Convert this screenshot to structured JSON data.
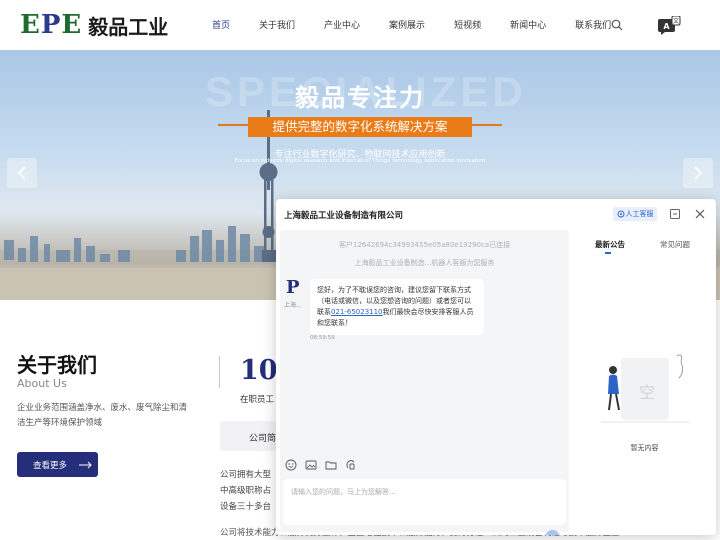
{
  "header": {
    "logo_letters": "EPE",
    "logo_cn": "毅品工业",
    "nav": [
      {
        "label": "首页",
        "active": true
      },
      {
        "label": "关于我们",
        "active": false
      },
      {
        "label": "产业中心",
        "active": false
      },
      {
        "label": "案例展示",
        "active": false
      },
      {
        "label": "短视频",
        "active": false
      },
      {
        "label": "新闻中心",
        "active": false
      },
      {
        "label": "联系我们",
        "active": false
      }
    ],
    "icons": [
      "search-icon",
      "chat-icon"
    ]
  },
  "hero": {
    "watermark": "SPECIALIZED",
    "title": "毅品专注力",
    "ribbon": "提供完整的数字化系统解决方案",
    "subtitle": "专注行业数字化研究、物联网技术应用创新",
    "subtitle_en": "Focus on industry digital research and Internet of Things technology application innovation",
    "colors": {
      "ribbon": "#ea7c17"
    }
  },
  "about": {
    "title": "关于我们",
    "title_en": "About Us",
    "description": "企业业务范围涵盖净水、废水、废气除尘和清洁生产等环境保护领域",
    "more_button": "查看更多",
    "stat_number": "10",
    "stat_label": "在职员工",
    "tab_label": "公司简介",
    "text_lines": [
      "公司拥有大型",
      "中高级职称占",
      "设备三十多台"
    ],
    "text_bottom": "公司将技术能力和服务优势互补，全面增强技术和服务能力，努力打造一流的工业设备制造与技术服务企业"
  },
  "chat": {
    "company": "上海毅品工业设备制造有限公司",
    "human_button": "人工客服",
    "sys_lines": [
      "客户12642694c34993455e05a80e19290ca已连接",
      "上海毅品工业设备制造...机器人客服为您服务"
    ],
    "bot_name": "上海...",
    "message_before_phone": "您好，为了不耽误您的咨询，建议您留下联系方式（电话或微信，以及您想咨询的问题）或者您可以联系",
    "message_phone": "021-65023110",
    "message_after_phone": "我们最快会尽快安排客服人员和您联系！",
    "message_time": "08:59:59",
    "input_placeholder": "请输入您的问题，马上为您解答...",
    "side_tabs": [
      "最新公告",
      "常见问题"
    ],
    "empty_glyph": "空",
    "empty_text": "暂无内容",
    "colors": {
      "accent": "#2d64c8",
      "brand": "#242e7a"
    }
  }
}
